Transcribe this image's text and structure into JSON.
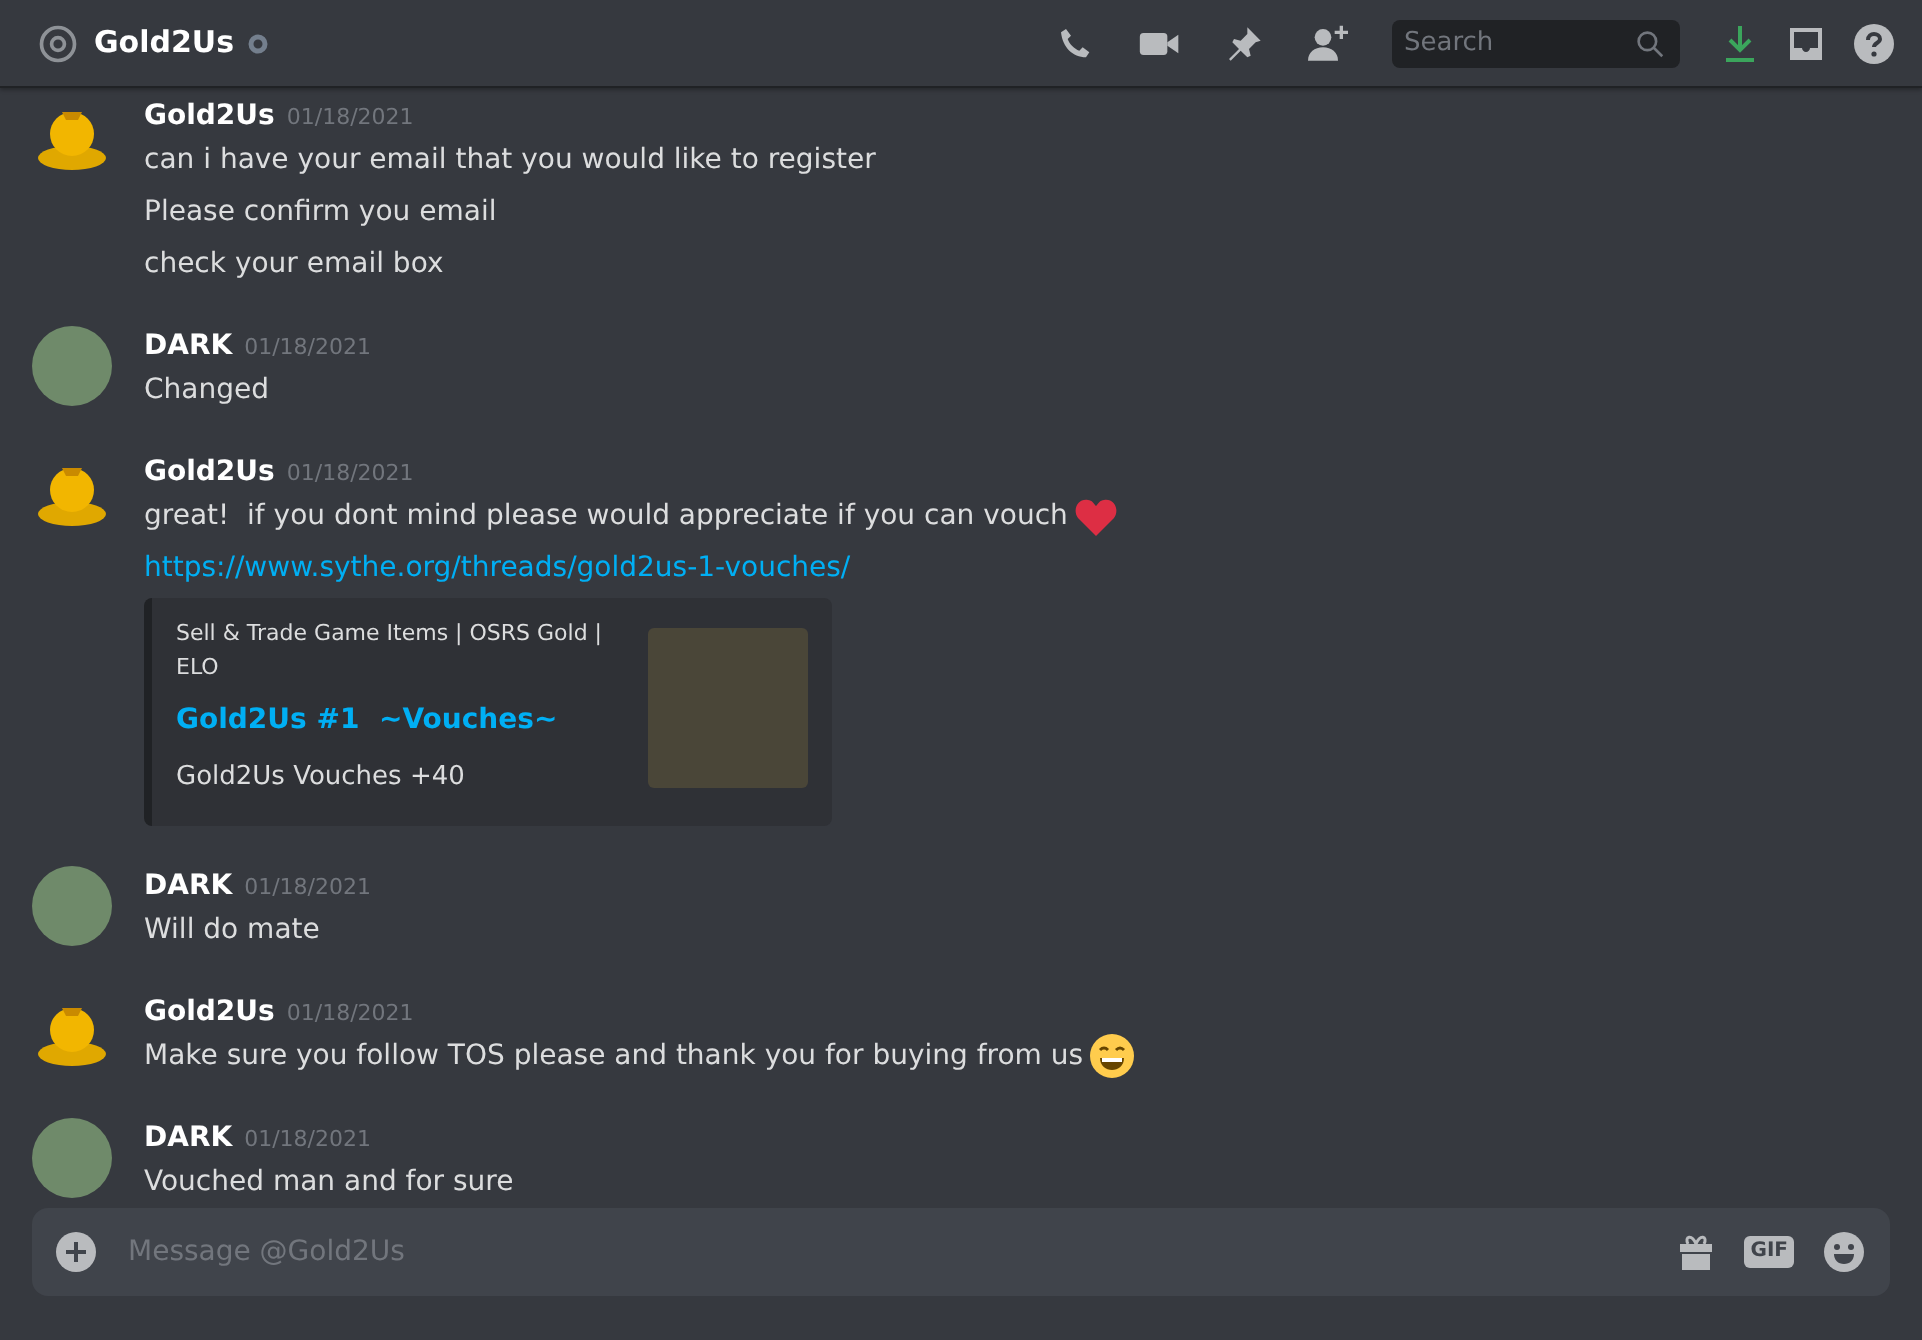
{
  "header": {
    "title": "Gold2Us",
    "search": {
      "placeholder": "Search"
    }
  },
  "messages": [
    {
      "author": "Gold2Us",
      "timestamp": "01/18/2021",
      "avatar": {
        "kind": "gold"
      },
      "lines": [
        {
          "kind": "text",
          "text": "can i have your email that you would like to register"
        },
        {
          "kind": "text",
          "text": "Please confirm you email"
        },
        {
          "kind": "text",
          "text": "check your email box"
        }
      ]
    },
    {
      "author": "DARK",
      "timestamp": "01/18/2021",
      "avatar": {
        "kind": "photo"
      },
      "lines": [
        {
          "kind": "text",
          "text": "Changed"
        }
      ]
    },
    {
      "author": "Gold2Us",
      "timestamp": "01/18/2021",
      "avatar": {
        "kind": "gold"
      },
      "lines": [
        {
          "kind": "text",
          "text": "great!  if you dont mind please would appreciate if you can vouch",
          "emoji": {
            "kind": "heart"
          }
        },
        {
          "kind": "link",
          "text": "https://www.sythe.org/threads/gold2us-1-vouches/"
        },
        {
          "kind": "embed",
          "provider": "Sell & Trade Game Items | OSRS Gold | ELO",
          "title": "Gold2Us #1  ~Vouches~",
          "description": "Gold2Us Vouches +40"
        }
      ]
    },
    {
      "author": "DARK",
      "timestamp": "01/18/2021",
      "avatar": {
        "kind": "photo"
      },
      "lines": [
        {
          "kind": "text",
          "text": "Will do mate"
        }
      ]
    },
    {
      "author": "Gold2Us",
      "timestamp": "01/18/2021",
      "avatar": {
        "kind": "gold"
      },
      "lines": [
        {
          "kind": "text",
          "text": "Make sure you follow TOS please and thank you for buying from us",
          "emoji": {
            "kind": "grin"
          }
        }
      ]
    },
    {
      "author": "DARK",
      "timestamp": "01/18/2021",
      "avatar": {
        "kind": "photo"
      },
      "lines": [
        {
          "kind": "text",
          "text": "Vouched man and for sure"
        }
      ]
    }
  ],
  "composer": {
    "placeholder": "Message @Gold2Us",
    "gif_label": "GIF"
  }
}
